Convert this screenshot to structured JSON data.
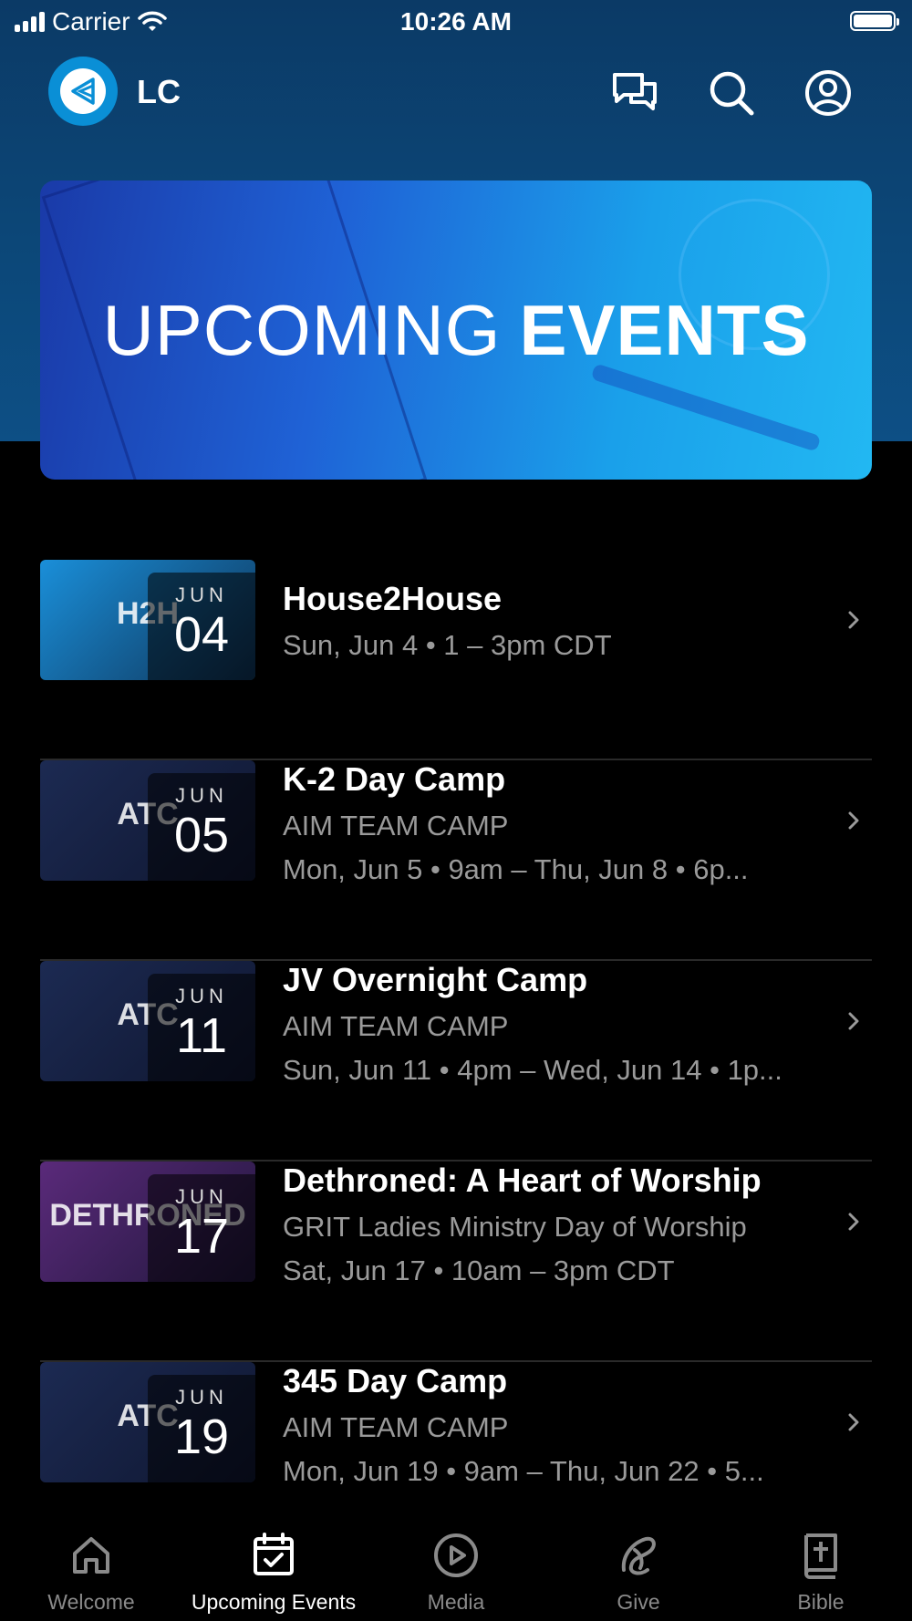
{
  "status_bar": {
    "carrier": "Carrier",
    "time": "10:26 AM"
  },
  "header": {
    "app_name": "LC",
    "icons": [
      "chat-icon",
      "search-icon",
      "profile-icon"
    ]
  },
  "banner": {
    "title_light": "UPCOMING",
    "title_bold": "EVENTS"
  },
  "events": [
    {
      "title": "House2House",
      "lines": [
        "Sun, Jun 4 • 1 – 3pm CDT"
      ],
      "month": "JUN",
      "day": "04",
      "thumb_label": "H2H",
      "thumb_color": "#1a8fd9"
    },
    {
      "title": "K-2 Day Camp",
      "lines": [
        "AIM TEAM CAMP",
        "Mon, Jun 5 • 9am – Thu, Jun 8 • 6p..."
      ],
      "month": "JUN",
      "day": "05",
      "thumb_label": "ATC",
      "thumb_color": "#1c2a52"
    },
    {
      "title": "JV Overnight Camp",
      "lines": [
        "AIM TEAM CAMP",
        "Sun, Jun 11 • 4pm – Wed, Jun 14 • 1p..."
      ],
      "month": "JUN",
      "day": "11",
      "thumb_label": "ATC",
      "thumb_color": "#1c2a52"
    },
    {
      "title": "Dethroned: A Heart of Worship",
      "lines": [
        "GRIT Ladies Ministry Day of Worship",
        "Sat, Jun 17 • 10am – 3pm CDT"
      ],
      "month": "JUN",
      "day": "17",
      "thumb_label": "DETHRONED",
      "thumb_color": "#5a2a7a"
    },
    {
      "title": "345 Day Camp",
      "lines": [
        "AIM TEAM CAMP",
        "Mon, Jun 19 • 9am – Thu, Jun 22 • 5..."
      ],
      "month": "JUN",
      "day": "19",
      "thumb_label": "ATC",
      "thumb_color": "#1c2a52"
    }
  ],
  "tabs": [
    {
      "label": "Welcome",
      "icon": "home-icon",
      "active": false
    },
    {
      "label": "Upcoming Events",
      "icon": "calendar-check-icon",
      "active": true
    },
    {
      "label": "Media",
      "icon": "play-icon",
      "active": false
    },
    {
      "label": "Give",
      "icon": "give-icon",
      "active": false
    },
    {
      "label": "Bible",
      "icon": "bible-icon",
      "active": false
    }
  ],
  "colors": {
    "accent": "#0a8fd6",
    "header_bg": "#0c4778",
    "muted_text": "#9a9a9a"
  }
}
